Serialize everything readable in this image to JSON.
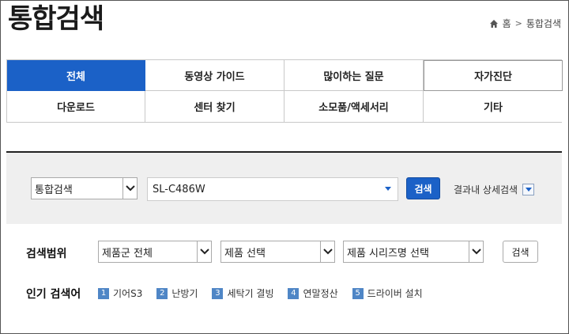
{
  "page": {
    "title": "통합검색"
  },
  "breadcrumb": {
    "home": "홈",
    "separator": ">",
    "current": "통합검색"
  },
  "tabs": [
    {
      "label": "전체",
      "active": true
    },
    {
      "label": "동영상 가이드"
    },
    {
      "label": "많이하는 질문"
    },
    {
      "label": "자가진단"
    },
    {
      "label": "다운로드"
    },
    {
      "label": "센터 찾기"
    },
    {
      "label": "소모품/액세서리"
    },
    {
      "label": "기타"
    }
  ],
  "search": {
    "scope_select": "통합검색",
    "query": "SL-C486W",
    "button": "검색",
    "detail_label": "결과내 상세검색"
  },
  "filters": {
    "range_label": "검색범위",
    "product_group": "제품군 전체",
    "product": "제품 선택",
    "series": "제품 시리즈명 선택",
    "button": "검색"
  },
  "popular": {
    "label": "인기 검색어",
    "items": [
      {
        "rank": "1",
        "text": "기어S3"
      },
      {
        "rank": "2",
        "text": "난방기"
      },
      {
        "rank": "3",
        "text": "세탁기 결빙"
      },
      {
        "rank": "4",
        "text": "연말정산"
      },
      {
        "rank": "5",
        "text": "드라이버 설치"
      }
    ]
  },
  "colors": {
    "accent": "#1b61c7",
    "rank_badge": "#4f86c6",
    "search_bg": "#efefef"
  }
}
